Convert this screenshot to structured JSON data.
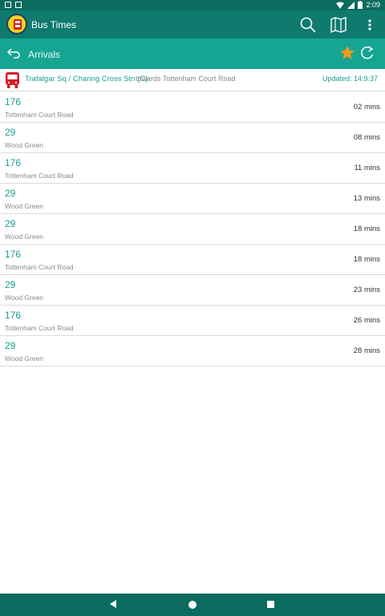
{
  "status_bar": {
    "time": "2:09",
    "icons": [
      "notification-icon",
      "photo-icon",
      "wifi-icon",
      "signal-icon",
      "battery-icon"
    ]
  },
  "app_bar": {
    "title": "Bus Times",
    "icons": [
      "app-logo",
      "search-icon",
      "map-icon",
      "more-vert-icon"
    ]
  },
  "sub_bar": {
    "title": "Arrivals",
    "icons": [
      "back-arrow-icon",
      "star-icon",
      "refresh-icon"
    ],
    "star_color": "#f29a1b"
  },
  "stop": {
    "name": "Trafalgar Sq / Charing Cross Stn (C)",
    "towards": "towards Tottenham Court Road",
    "updated": "Updated: 14:9:37",
    "icon": "bus-stop-icon"
  },
  "arrivals": [
    {
      "route": "176",
      "destination": "Tottenham Court Road",
      "eta": "02 mins"
    },
    {
      "route": "29",
      "destination": "Wood Green",
      "eta": "08 mins"
    },
    {
      "route": "176",
      "destination": "Tottenham Court Road",
      "eta": "11 mins"
    },
    {
      "route": "29",
      "destination": "Wood Green",
      "eta": "13 mins"
    },
    {
      "route": "29",
      "destination": "Wood Green",
      "eta": "18 mins"
    },
    {
      "route": "176",
      "destination": "Tottenham Court Road",
      "eta": "18 mins"
    },
    {
      "route": "29",
      "destination": "Wood Green",
      "eta": "23 mins"
    },
    {
      "route": "176",
      "destination": "Tottenham Court Road",
      "eta": "26 mins"
    },
    {
      "route": "29",
      "destination": "Wood Green",
      "eta": "28 mins"
    }
  ],
  "nav_bar": {
    "icons": [
      "nav-back-icon",
      "nav-home-icon",
      "nav-recents-icon"
    ]
  },
  "colors": {
    "primary_dark": "#0b6b5f",
    "primary": "#0e7b6e",
    "accent": "#16a593",
    "route_text": "#18a08f",
    "bus_red": "#d81b24"
  }
}
